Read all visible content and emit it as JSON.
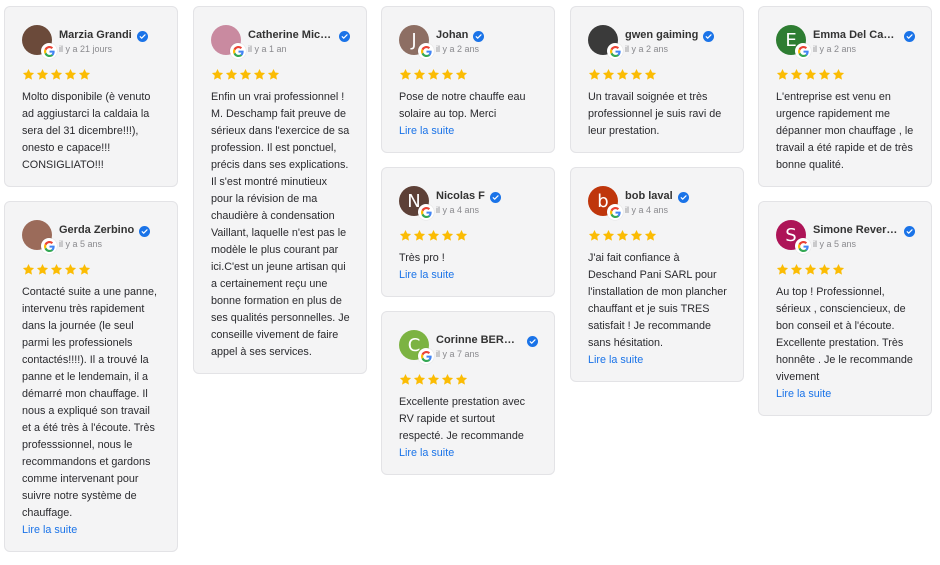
{
  "more_label": "Lire la suite",
  "columns": [
    [
      {
        "name": "Marzia Grandi",
        "date": "il y a 21 jours",
        "initial": "",
        "avatar_color": "#6b4a3a",
        "rating": 5,
        "text": "Molto disponibile (è venuto ad aggiustarci la caldaia la sera del 31 dicembre!!!), onesto e capace!!! CONSIGLIATO!!!",
        "show_more": false
      },
      {
        "name": "Gerda Zerbino",
        "date": "il y a 5 ans",
        "initial": "",
        "avatar_color": "#9b6b5a",
        "rating": 5,
        "text": "Contacté suite a une panne, intervenu très rapidement dans la journée (le seul parmi les professionels contactés!!!!). Il a trouvé la panne et le lendemain, il a démarré mon chauffage. Il nous a expliqué son travail et a été très à l'écoute. Très professsionnel, nous le recommandons et gardons comme intervenant pour suivre notre système de chauffage.",
        "show_more": true
      }
    ],
    [
      {
        "name": "Catherine Michel",
        "date": "il y a 1 an",
        "initial": "",
        "avatar_color": "#c98aa0",
        "rating": 5,
        "text": "Enfin un vrai professionnel ! M. Deschamp fait preuve de sérieux dans l'exercice de sa profession. Il est ponctuel, précis dans ses explications. Il s'est montré minutieux pour la révision de ma chaudière à condensation Vaillant, laquelle n'est pas le modèle le plus courant par ici.C'est un jeune artisan qui a certainement reçu une bonne formation en plus de ses qualités personnelles. Je conseille vivement de faire appel à ses services.",
        "show_more": false
      }
    ],
    [
      {
        "name": "Johan",
        "date": "il y a 2 ans",
        "initial": "J",
        "avatar_color": "#8d6e63",
        "rating": 5,
        "text": "Pose de notre chauffe eau solaire au top. Merci",
        "show_more": true
      },
      {
        "name": "Nicolas F",
        "date": "il y a 4 ans",
        "initial": "N",
        "avatar_color": "#5d4037",
        "rating": 5,
        "text": "Très pro !",
        "show_more": true
      },
      {
        "name": "Corinne BERNA...",
        "date": "il y a 7 ans",
        "initial": "C",
        "avatar_color": "#7cb342",
        "rating": 5,
        "text": "Excellente prestation avec RV rapide et surtout respecté. Je recommande",
        "show_more": true
      }
    ],
    [
      {
        "name": "gwen gaiming",
        "date": "il y a 2 ans",
        "initial": "",
        "avatar_color": "#3a3a3a",
        "rating": 5,
        "text": "Un travail soignée et très professionnel je suis ravi de leur prestation.",
        "show_more": false
      },
      {
        "name": "bob laval",
        "date": "il y a 4 ans",
        "initial": "b",
        "avatar_color": "#bf360c",
        "rating": 5,
        "text": "J'ai fait confiance à Deschand Pani SARL pour l'installation de mon plancher chauffant et je suis TRES satisfait ! Je recommande sans hésitation.",
        "show_more": true
      }
    ],
    [
      {
        "name": "Emma Del Cam...",
        "date": "il y a 2 ans",
        "initial": "E",
        "avatar_color": "#2e7d32",
        "rating": 5,
        "text": "L'entreprise est venu en urgence rapidement me dépanner mon chauffage , le travail a été rapide et de très bonne qualité.",
        "show_more": false
      },
      {
        "name": "Simone Reversat",
        "date": "il y a 5 ans",
        "initial": "S",
        "avatar_color": "#ad1457",
        "rating": 5,
        "text": "Au top ! Professionnel, sérieux , consciencieux, de bon conseil et à l'écoute. Excellente prestation. Très honnête . Je le recommande vivement",
        "show_more": true
      }
    ]
  ],
  "icons": {
    "verified": "verified-badge-icon",
    "google": "google-g-icon",
    "star": "star-icon"
  },
  "colors": {
    "star": "#fbbc04",
    "link": "#1a73e8",
    "verified": "#1a73e8"
  }
}
